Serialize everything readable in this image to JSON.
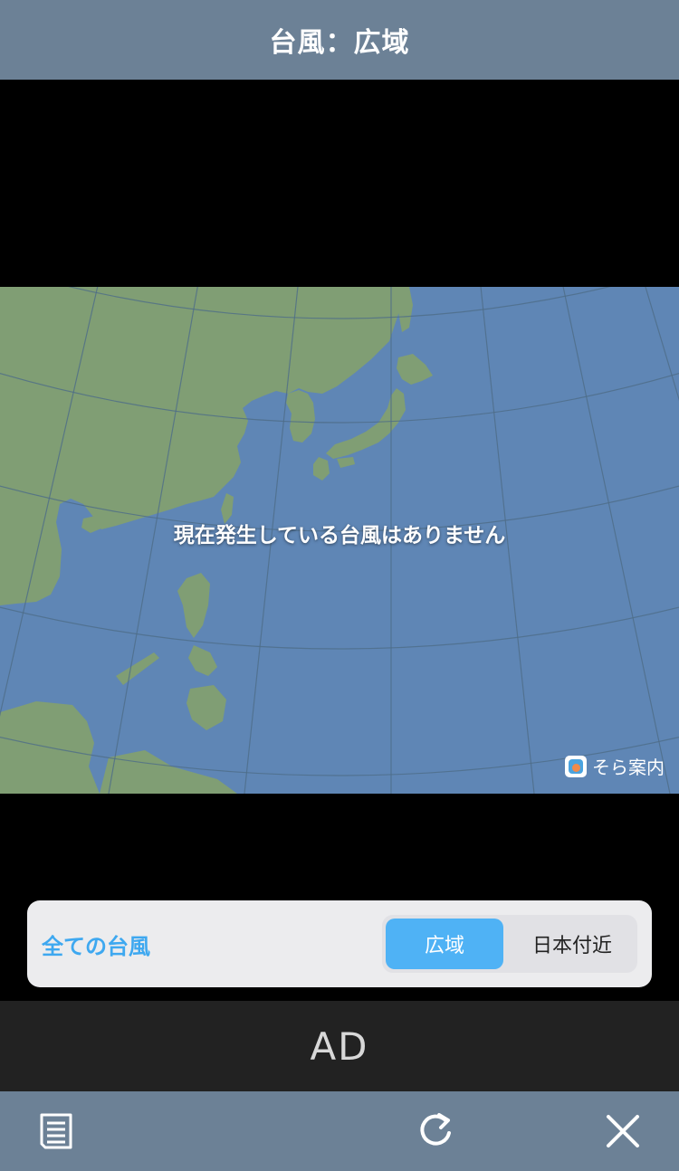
{
  "header": {
    "title": "台風：広域"
  },
  "map": {
    "message": "現在発生している台風はありません",
    "logo_text": "そら案内",
    "colors": {
      "sea": "#5f86b5",
      "land": "#809e74",
      "grid": "#4e6d88"
    }
  },
  "panel": {
    "all_typhoons_label": "全ての台風",
    "segments": [
      {
        "label": "広域",
        "selected": true
      },
      {
        "label": "日本付近",
        "selected": false
      }
    ],
    "accent": "#4fb2f5"
  },
  "ad": {
    "label": "AD"
  },
  "toolbar": {
    "icons": [
      "list-icon",
      "refresh-icon",
      "close-icon"
    ]
  }
}
